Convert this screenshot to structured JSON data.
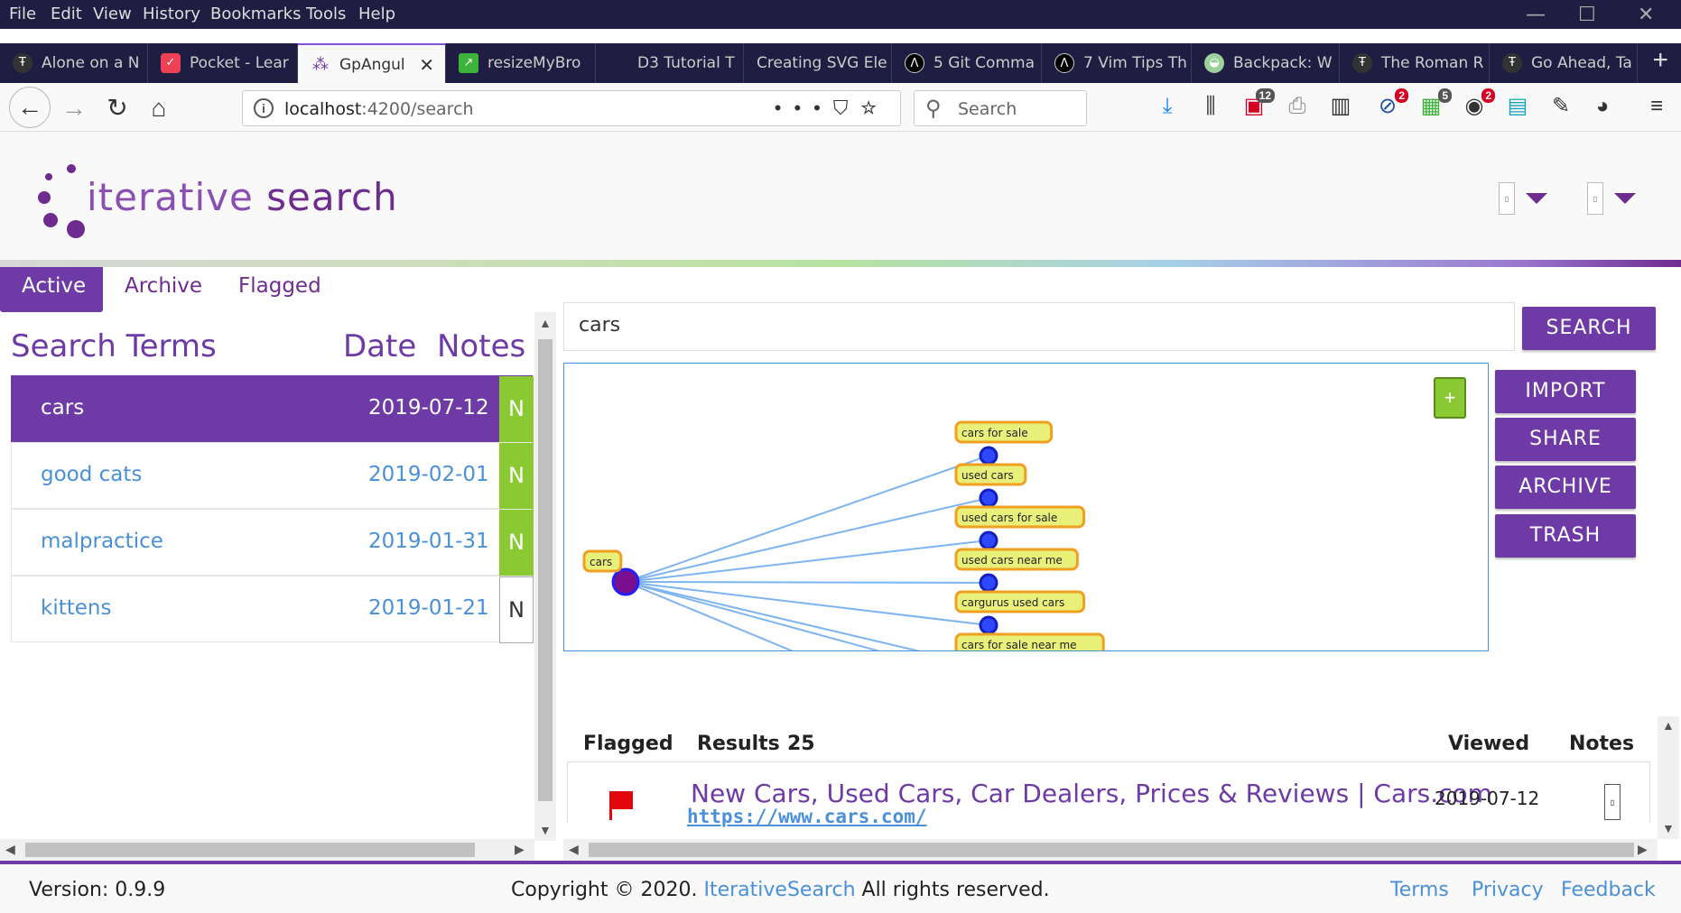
{
  "browser": {
    "menu": [
      "File",
      "Edit",
      "View",
      "History",
      "Bookmarks",
      "Tools",
      "Help"
    ],
    "tabs": [
      {
        "label": "Alone on a N",
        "icon": "nyt-icon"
      },
      {
        "label": "Pocket - Lear",
        "icon": "pocket-icon"
      },
      {
        "label": "GpAngul",
        "icon": "loading-icon",
        "active": true
      },
      {
        "label": "resizeMyBro",
        "icon": "resize-icon"
      },
      {
        "label": "D3 Tutorial T",
        "icon": "blank-icon"
      },
      {
        "label": "Creating SVG Ele",
        "icon": "blank-icon"
      },
      {
        "label": "5 Git Comma",
        "icon": "dev-icon"
      },
      {
        "label": "7 Vim Tips Th",
        "icon": "dev-icon"
      },
      {
        "label": "Backpack: W",
        "icon": "backpack-icon"
      },
      {
        "label": "The Roman R",
        "icon": "nyt-icon"
      },
      {
        "label": "Go Ahead, Ta",
        "icon": "nyt-icon"
      }
    ],
    "url_host": "localhost",
    "url_path": ":4200/search",
    "search_placeholder": "Search",
    "badges": {
      "pocket_list": "12",
      "ext_a": "2",
      "ext_b": "5",
      "ext_c": "2"
    }
  },
  "app": {
    "logo_word1": "iterative",
    "logo_word2": " search",
    "tabs": [
      "Active",
      "Archive",
      "Flagged"
    ],
    "terms_header": {
      "term": "Search Terms",
      "date": "Date",
      "notes": "Notes"
    },
    "terms": [
      {
        "term": "cars",
        "date": "2019-07-12",
        "note": "N",
        "selected": true
      },
      {
        "term": "good cats",
        "date": "2019-02-01",
        "note": "N"
      },
      {
        "term": "malpractice",
        "date": "2019-01-31",
        "note": "N"
      },
      {
        "term": "kittens",
        "date": "2019-01-21",
        "note": "N"
      }
    ],
    "query": "cars",
    "buttons": {
      "search": "SEARCH",
      "import": "IMPORT",
      "share": "SHARE",
      "archive": "ARCHIVE",
      "trash": "TRASH",
      "add": "+"
    },
    "graph": {
      "root": "cars",
      "children": [
        "cars for sale",
        "used cars",
        "used cars for sale",
        "used cars near me",
        "cargurus used cars",
        "cars for sale near me"
      ]
    },
    "results_header": {
      "flagged": "Flagged",
      "results": "Results",
      "count": "25",
      "viewed": "Viewed",
      "notes": "Notes"
    },
    "result": {
      "title": "New Cars, Used Cars, Car Dealers, Prices & Reviews | Cars.com",
      "url": "https://www.cars.com/",
      "viewed": "2019-07-12"
    },
    "footer": {
      "version": "Version: 0.9.9",
      "copyright_pre": "Copyright © 2020. ",
      "brand": "IterativeSearch",
      "copyright_post": " All rights reserved.",
      "terms": "Terms",
      "privacy": "Privacy",
      "feedback": "Feedback"
    }
  }
}
